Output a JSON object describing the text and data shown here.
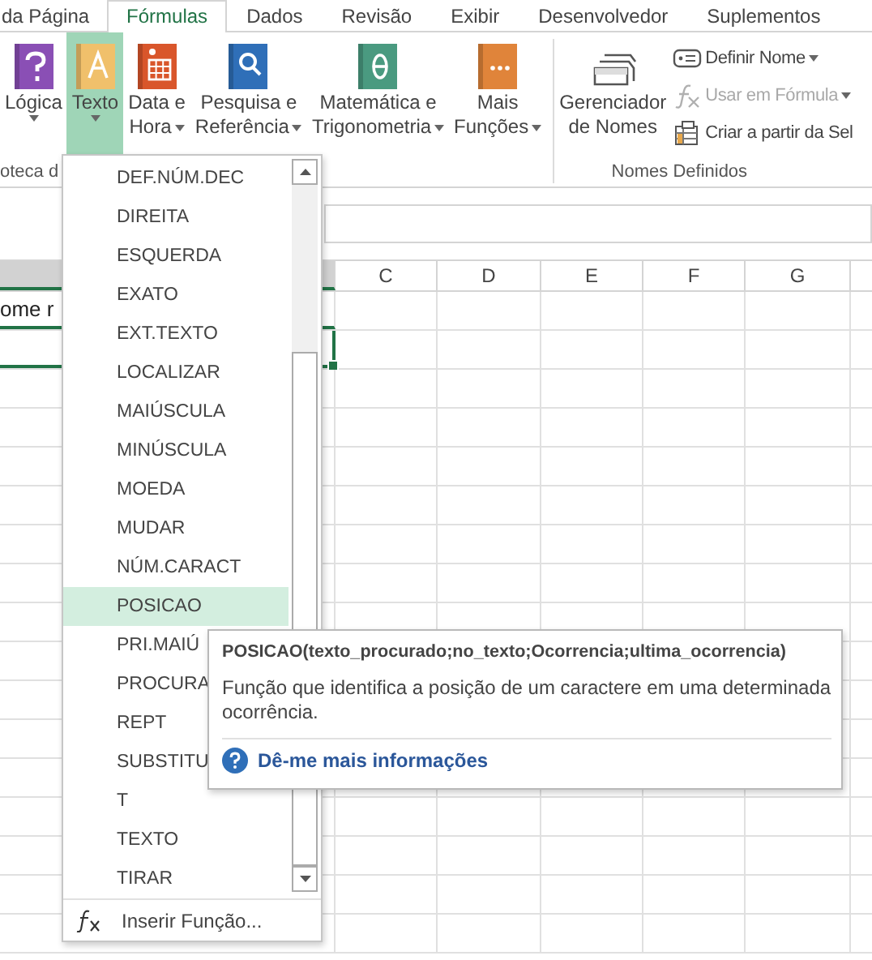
{
  "ribbon_tabs": [
    {
      "label": "da Página",
      "selected": false
    },
    {
      "label": "Fórmulas",
      "selected": true
    },
    {
      "label": "Dados",
      "selected": false
    },
    {
      "label": "Revisão",
      "selected": false
    },
    {
      "label": "Exibir",
      "selected": false
    },
    {
      "label": "Desenvolvedor",
      "selected": false
    },
    {
      "label": "Suplementos",
      "selected": false
    }
  ],
  "function_library": {
    "group_label": "oteca d",
    "buttons": [
      {
        "kind": "logical",
        "lines": [
          "Lógica"
        ],
        "selected": false
      },
      {
        "kind": "text",
        "lines": [
          "Texto"
        ],
        "selected": true
      },
      {
        "kind": "datetime",
        "lines": [
          "Data e",
          "Hora"
        ],
        "selected": false
      },
      {
        "kind": "lookup",
        "lines": [
          "Pesquisa e",
          "Referência"
        ],
        "selected": false
      },
      {
        "kind": "math",
        "lines": [
          "Matemática e",
          "Trigonometria"
        ],
        "selected": false
      },
      {
        "kind": "more",
        "lines": [
          "Mais",
          "Funções"
        ],
        "selected": false
      }
    ]
  },
  "defined_names": {
    "group_label": "Nomes Definidos",
    "manager": {
      "lines": [
        "Gerenciador",
        "de Nomes"
      ]
    },
    "commands": [
      {
        "kind": "tag",
        "label": "Definir Nome",
        "disabled": false,
        "dropdown": true
      },
      {
        "kind": "fx",
        "label": "Usar em Fórmula",
        "disabled": true,
        "dropdown": true
      },
      {
        "kind": "table",
        "label": "Criar a partir da Sel",
        "disabled": false,
        "dropdown": false
      }
    ]
  },
  "sheet": {
    "columns": [
      "C",
      "D",
      "E",
      "F",
      "G"
    ],
    "cell_text": "ome r"
  },
  "text_functions_menu": {
    "items": [
      {
        "label": "DEF.NÚM.DEC",
        "selected": false
      },
      {
        "label": "DIREITA",
        "selected": false
      },
      {
        "label": "ESQUERDA",
        "selected": false
      },
      {
        "label": "EXATO",
        "selected": false
      },
      {
        "label": "EXT.TEXTO",
        "selected": false
      },
      {
        "label": "LOCALIZAR",
        "selected": false
      },
      {
        "label": "MAIÚSCULA",
        "selected": false
      },
      {
        "label": "MINÚSCULA",
        "selected": false
      },
      {
        "label": "MOEDA",
        "selected": false
      },
      {
        "label": "MUDAR",
        "selected": false
      },
      {
        "label": "NÚM.CARACT",
        "selected": false
      },
      {
        "label": "POSICAO",
        "selected": true
      },
      {
        "label": "PRI.MAIÚ",
        "selected": false
      },
      {
        "label": "PROCURA",
        "selected": false
      },
      {
        "label": "REPT",
        "selected": false
      },
      {
        "label": "SUBSTITU",
        "selected": false
      },
      {
        "label": "T",
        "selected": false
      },
      {
        "label": "TEXTO",
        "selected": false
      },
      {
        "label": "TIRAR",
        "selected": false
      }
    ],
    "footer": "Inserir Função..."
  },
  "tooltip": {
    "title": "POSICAO(texto_procurado;no_texto;Ocorrencia;ultima_ocorrencia)",
    "description": "Função que identifica a posição de um caractere em uma determinada ocorrência.",
    "help_link": "Dê-me mais informações"
  }
}
